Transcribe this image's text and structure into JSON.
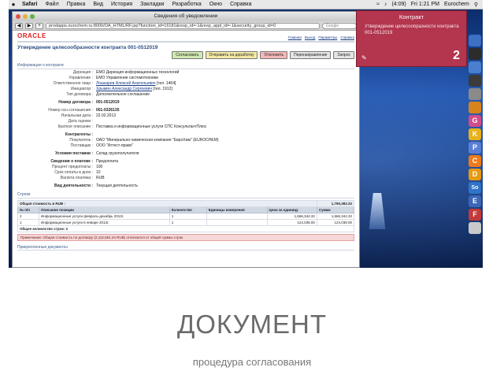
{
  "menubar": {
    "items": [
      "Safari",
      "Файл",
      "Правка",
      "Вид",
      "История",
      "Закладки",
      "Разработка",
      "Окно",
      "Справка"
    ],
    "battery": "(4:09)",
    "clock": "Fri 1:21 PM",
    "user": "Eurochem"
  },
  "browser": {
    "window_title": "Сведения об уведомлении",
    "url": "prodapps.eurochem.ru:8000/OA_HTML/RF.jsp?function_id=16181&resp_id=-1&resp_appl_id=-1&security_group_id=0",
    "search_placeholder": "Google"
  },
  "page": {
    "logo": "ORACLE",
    "top_links": [
      "Главная",
      "Выход",
      "Параметры",
      "Справка"
    ],
    "title": "Утверждение целесообразности контракта 001-0512019",
    "actions": [
      "Согласовать",
      "Отправить на доработку",
      "Отклонить",
      "Перенаправление",
      "Запрос"
    ],
    "sections": {
      "contract_info": "Информация о контракте",
      "conditions": "Условия поставки",
      "payment": "Сведения о платеже",
      "lines": "Строки",
      "attachments": "Прикрепленные документы"
    },
    "fields": {
      "direction_l": "Дирекция :",
      "direction_v": "ЕМО Дирекция информационных технологий",
      "department_l": "Управление :",
      "department_v": "ЕМО Управление системотехники",
      "responsible_l": "Ответственное лицо :",
      "responsible_v": "Лошкарев Алексей Анатольевич",
      "responsible_n": "[тел. 1464]",
      "initiator_l": "Инициатор :",
      "initiator_v": "Хрымин Александр Сергеевич",
      "initiator_n": "[тел. 1912]",
      "type_l": "Тип договора :",
      "type_v": "Дополнительное соглашение",
      "contract_l": "Номер договора :",
      "contract_v": "001-0512019",
      "agreement_l": "Номер осн.соглашения :",
      "agreement_v": "001-0326135",
      "start_l": "Начальная дата :",
      "start_v": "22.02.2013",
      "end_l": "Дата оценки :",
      "end_v": "",
      "summary_l": "Краткое описание :",
      "summary_v": "Поставка и информационные услуги СПС КонсультантПлюс",
      "counterparties_l": "Контрагенты :",
      "buyer_l": "Покупатель :",
      "buyer_v": "ОАО \"Минерально-химическая компания \"ЕвроХим\" (EUROCHEM)",
      "supplier_l": "Поставщик :",
      "supplier_v": "ООО \"Аттест-право\"",
      "delivery_l": "Условия поставки :",
      "delivery_v": "Склад грузополучателя",
      "payment_l": "Сведения о платеже :",
      "payment_v": "Предоплата",
      "prepay_l": "Процент предоплаты :",
      "prepay_v": "100",
      "term_l": "Срок оплаты в днях :",
      "term_v": "10",
      "currency_l": "Валюта платежа :",
      "currency_v": "RUB",
      "activity_l": "Вид деятельности :",
      "activity_v": "Текущая деятельность"
    },
    "lines_table": {
      "total_label": "Общая стоимость в RUB :",
      "total_value": "1,790,383.32",
      "headers": [
        "№ п/п",
        "Описание позиции",
        "Количество",
        "Единицы измерения",
        "Цена за единицу",
        "Сумма"
      ],
      "rows": [
        [
          "2",
          "Информационные услуги февраль-декабрь 2013г.",
          "1",
          "",
          "1,666,344.32",
          "1,666,344.32"
        ],
        [
          "1",
          "Информационные услуги в январе 2013г.",
          "1",
          "",
          "124,038.00",
          "124,038.00"
        ]
      ],
      "count_label": "Общее количество строк: 2",
      "note": "Примечание: Общая стоимость по договору (2,112,651.24 RUB) отличается от общей суммы строк"
    }
  },
  "notification": {
    "title": "Контракт",
    "subtitle": "Утверждение целесообразности контракта 001-0512019",
    "count": "2"
  },
  "dock": {
    "letters": [
      "",
      "",
      "",
      "",
      "",
      "",
      "G",
      "K",
      "P",
      "C",
      "D",
      "So",
      "E",
      "F",
      ""
    ]
  },
  "slide": {
    "title": "ДОКУМЕНТ",
    "subtitle": "процедура согласования"
  },
  "colors": {
    "notification_bg": "#b3354e",
    "oracle_red": "#e21b1b",
    "approve": "#cfe8b0",
    "return": "#f3e9a6",
    "reject": "#f4b7b7"
  }
}
